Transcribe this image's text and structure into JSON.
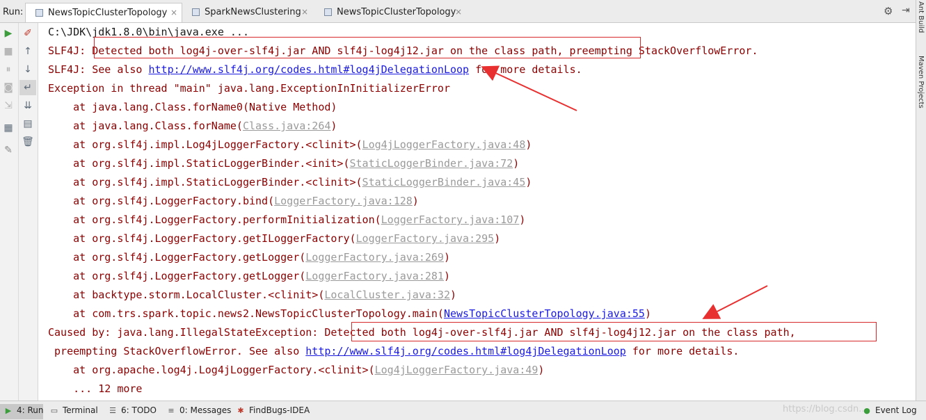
{
  "run_panel": {
    "label": "Run:",
    "tabs": [
      {
        "label": "NewsTopicClusterTopology",
        "active": true
      },
      {
        "label": "SparkNewsClustering",
        "active": false
      },
      {
        "label": "NewsTopicClusterTopology",
        "active": false
      }
    ],
    "close_glyph": "×",
    "settings_glyph": "⚙",
    "hide_glyph": "⇥"
  },
  "toolbar": {
    "run_glyph": "▶",
    "stop_glyph": "■",
    "pause_glyph": "⏸",
    "snapshot_glyph": "◙",
    "login_glyph": "⇲",
    "layout_glyph": "▦",
    "pin_glyph": "✎",
    "rerun_glyph": "✐",
    "up_glyph": "↑",
    "down_glyph": "↓",
    "wrap_glyph": "↵",
    "scroll_end_glyph": "⇊",
    "print_glyph": "▤",
    "trash_glyph": "🗑"
  },
  "console": {
    "lines": [
      {
        "text": "C:\\JDK\\jdk1.8.0\\bin\\java.exe ...",
        "style": "plain"
      },
      {
        "text": "SLF4J: Detected both log4j-over-slf4j.jar AND slf4j-log4j12.jar on the class path, preempting StackOverflowError."
      },
      {
        "text": "SLF4J: See also ",
        "link": "http://www.slf4j.org/codes.html#log4jDelegationLoop",
        "link_style": "blue",
        "after": " for more details."
      },
      {
        "text": "Exception in thread \"main\" java.lang.ExceptionInInitializerError"
      },
      {
        "text": "    at java.lang.Class.forName0(Native Method)"
      },
      {
        "text": "    at java.lang.Class.forName(",
        "link": "Class.java:264",
        "link_style": "gray",
        "after": ")"
      },
      {
        "text": "    at org.slf4j.impl.Log4jLoggerFactory.<clinit>(",
        "link": "Log4jLoggerFactory.java:48",
        "link_style": "gray",
        "after": ")"
      },
      {
        "text": "    at org.slf4j.impl.StaticLoggerBinder.<init>(",
        "link": "StaticLoggerBinder.java:72",
        "link_style": "gray",
        "after": ")"
      },
      {
        "text": "    at org.slf4j.impl.StaticLoggerBinder.<clinit>(",
        "link": "StaticLoggerBinder.java:45",
        "link_style": "gray",
        "after": ")"
      },
      {
        "text": "    at org.slf4j.LoggerFactory.bind(",
        "link": "LoggerFactory.java:128",
        "link_style": "gray",
        "after": ")"
      },
      {
        "text": "    at org.slf4j.LoggerFactory.performInitialization(",
        "link": "LoggerFactory.java:107",
        "link_style": "gray",
        "after": ")"
      },
      {
        "text": "    at org.slf4j.LoggerFactory.getILoggerFactory(",
        "link": "LoggerFactory.java:295",
        "link_style": "gray",
        "after": ")"
      },
      {
        "text": "    at org.slf4j.LoggerFactory.getLogger(",
        "link": "LoggerFactory.java:269",
        "link_style": "gray",
        "after": ")"
      },
      {
        "text": "    at org.slf4j.LoggerFactory.getLogger(",
        "link": "LoggerFactory.java:281",
        "link_style": "gray",
        "after": ")"
      },
      {
        "text": "    at backtype.storm.LocalCluster.<clinit>(",
        "link": "LocalCluster.java:32",
        "link_style": "gray",
        "after": ")"
      },
      {
        "text": "    at com.trs.spark.topic.news2.NewsTopicClusterTopology.main(",
        "link": "NewsTopicClusterTopology.java:55",
        "link_style": "blue",
        "after": ")"
      },
      {
        "text": "Caused by: java.lang.IllegalStateException: Detected both log4j-over-slf4j.jar AND slf4j-log4j12.jar on the class path,"
      },
      {
        "text": " preempting StackOverflowError. See also ",
        "link": "http://www.slf4j.org/codes.html#log4jDelegationLoop",
        "link_style": "blue",
        "after": " for more details."
      },
      {
        "text": "    at org.apache.log4j.Log4jLoggerFactory.<clinit>(",
        "link": "Log4jLoggerFactory.java:49",
        "link_style": "gray",
        "after": ")"
      },
      {
        "text": "    ... 12 more"
      }
    ]
  },
  "right_sidebar": {
    "ant_build": "Ant Build",
    "maven_projects": "Maven Projects"
  },
  "bottom_bar": {
    "tools": [
      {
        "label": "4: Run",
        "icon": "▶",
        "active": true
      },
      {
        "label": "Terminal",
        "icon": "▭",
        "active": false
      },
      {
        "label": "6: TODO",
        "icon": "☰",
        "active": false
      },
      {
        "label": "0: Messages",
        "icon": "≡",
        "active": false
      },
      {
        "label": "FindBugs-IDEA",
        "icon": "✱",
        "active": false
      }
    ],
    "event_log": "Event Log",
    "watermark": "https://blog.csdn..."
  },
  "colors": {
    "error_text": "#8b0000",
    "plain_text": "#1a1a1a",
    "link_blue": "#1a1ae0",
    "link_gray": "#9a9a9a",
    "annotation_red": "#d62828"
  }
}
